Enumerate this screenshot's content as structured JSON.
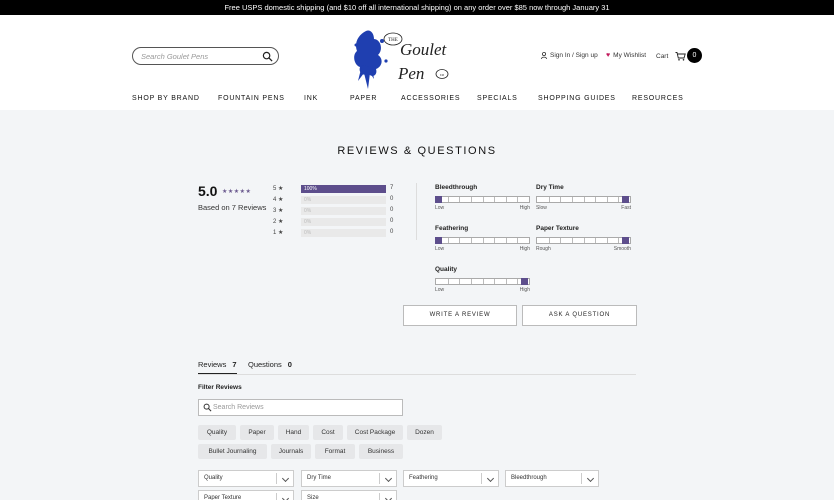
{
  "announcement": "Free USPS domestic shipping (and $10 off all international shipping) on any order over $85 now through January 31",
  "header": {
    "search_placeholder": "Search Goulet Pens",
    "logo": {
      "the": "THE",
      "goulet": "Goulet",
      "pen": "Pen",
      "co": "co"
    },
    "signin": "Sign In / Sign up",
    "wishlist": "My Wishlist",
    "cart": "Cart",
    "cart_count": "0"
  },
  "nav": [
    "SHOP BY BRAND",
    "FOUNTAIN PENS",
    "INK",
    "PAPER",
    "ACCESSORIES",
    "SPECIALS",
    "SHOPPING GUIDES",
    "RESOURCES"
  ],
  "reviews": {
    "title": "REVIEWS & QUESTIONS",
    "average": "5.0",
    "stars": "★★★★★",
    "based_on": "Based on 7 Reviews",
    "histogram": [
      {
        "label": "5 ★",
        "pct_text": "100%",
        "fraction": 1.0,
        "count": "7"
      },
      {
        "label": "4 ★",
        "pct_text": "0%",
        "fraction": 0,
        "count": "0"
      },
      {
        "label": "3 ★",
        "pct_text": "0%",
        "fraction": 0,
        "count": "0"
      },
      {
        "label": "2 ★",
        "pct_text": "0%",
        "fraction": 0,
        "count": "0"
      },
      {
        "label": "1 ★",
        "pct_text": "0%",
        "fraction": 0,
        "count": "0"
      }
    ],
    "attributes": [
      {
        "name": "Bleedthrough",
        "low": "Low",
        "high": "High",
        "value": 0
      },
      {
        "name": "Dry Time",
        "low": "Slow",
        "high": "Fast",
        "value": 1
      },
      {
        "name": "Feathering",
        "low": "Low",
        "high": "High",
        "value": 0
      },
      {
        "name": "Paper Texture",
        "low": "Rough",
        "high": "Smooth",
        "value": 1
      },
      {
        "name": "Quality",
        "low": "Low",
        "high": "High",
        "value": 1
      }
    ],
    "write_review": "WRITE A REVIEW",
    "ask_question": "ASK A QUESTION"
  },
  "tabs": [
    {
      "label": "Reviews",
      "count": "7"
    },
    {
      "label": "Questions",
      "count": "0"
    }
  ],
  "filter": {
    "title": "Filter Reviews",
    "search_placeholder": "Search Reviews",
    "chips": [
      "Quality",
      "Paper",
      "Hand",
      "Cost",
      "Cost Package",
      "Dozen",
      "Bullet Journaling",
      "Journals",
      "Format",
      "Business"
    ],
    "dropdowns": [
      "Quality",
      "Dry Time",
      "Feathering",
      "Bleedthrough",
      "Paper Texture",
      "Size"
    ]
  }
}
